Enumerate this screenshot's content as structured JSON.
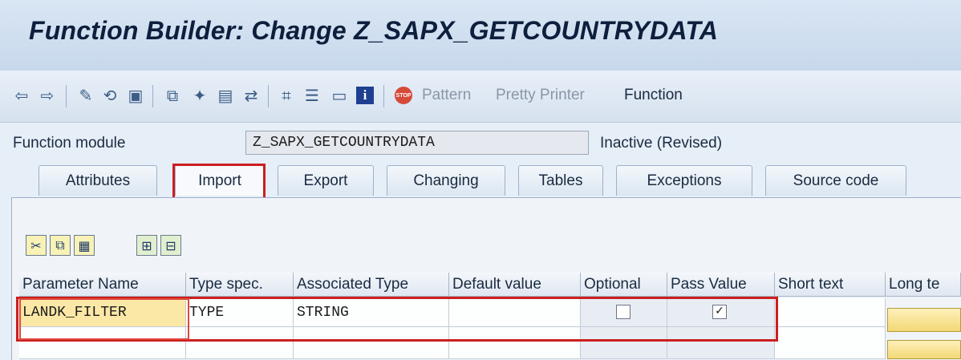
{
  "window": {
    "title": "Function Builder: Change Z_SAPX_GETCOUNTRYDATA"
  },
  "toolbar": {
    "icons": [
      "back-arrow-icon",
      "forward-arrow-icon",
      "edit-pencil-icon",
      "display-change-icon",
      "activate-icon",
      "where-used-icon",
      "object-list-icon",
      "navigation-window-icon",
      "check-icon",
      "transport-icon",
      "hierarchy-icon",
      "other-object-icon",
      "info-list-icon",
      "info-icon",
      "stop-icon"
    ],
    "pattern_label": "Pattern",
    "pretty_printer_label": "Pretty Printer",
    "function_label": "Function"
  },
  "header": {
    "function_module_label": "Function module",
    "function_module_value": "Z_SAPX_GETCOUNTRYDATA",
    "status": "Inactive (Revised)"
  },
  "tabs": [
    {
      "label": "Attributes"
    },
    {
      "label": "Import"
    },
    {
      "label": "Export"
    },
    {
      "label": "Changing"
    },
    {
      "label": "Tables"
    },
    {
      "label": "Exceptions"
    },
    {
      "label": "Source code"
    }
  ],
  "selected_tab": "Import",
  "edit_toolbar": {
    "icons": [
      "cut-icon",
      "copy-icon",
      "paste-icon",
      "insert-row-icon",
      "delete-row-icon"
    ]
  },
  "table": {
    "columns": [
      "Parameter Name",
      "Type spec.",
      "Associated Type",
      "Default value",
      "Optional",
      "Pass Value",
      "Short text",
      "Long te"
    ],
    "rows": [
      {
        "name": "LANDK_FILTER",
        "type_spec": "TYPE",
        "associated_type": "STRING",
        "default_value": "",
        "optional": false,
        "pass_value": true,
        "short_text": ""
      }
    ]
  },
  "colors": {
    "highlight": "#cc1f1f",
    "title_text": "#0d1f3c",
    "input_yellow": "#fbe8a6"
  }
}
